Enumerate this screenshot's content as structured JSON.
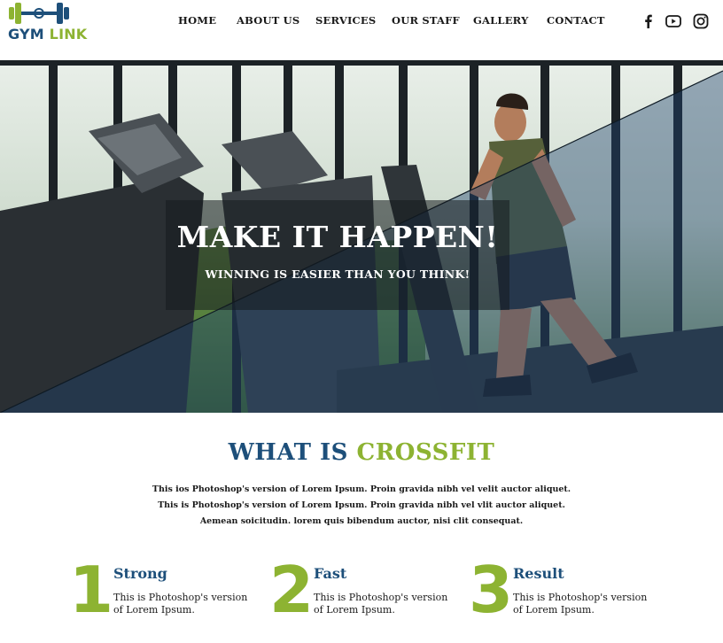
{
  "brand": {
    "name_part1": "GYM",
    "name_part2": "LINK",
    "logo_icon": "dumbbell-icon",
    "colors": {
      "blue": "#1d4f7a",
      "green": "#8db332"
    }
  },
  "nav": {
    "items": [
      "HOME",
      "ABOUT US",
      "SERVICES",
      "OUR STAFF",
      "GALLERY",
      "CONTACT"
    ]
  },
  "social": [
    "facebook-icon",
    "youtube-icon",
    "instagram-icon"
  ],
  "hero": {
    "title": "MAKE IT HAPPEN!",
    "subtitle": "WINNING IS EASIER THAN YOU THINK!"
  },
  "about": {
    "title_part1": "WHAT IS",
    "title_part2": "CROSSFIT",
    "lines": [
      "This ios Photoshop's version of Lorem Ipsum. Proin gravida nibh vel velit auctor aliquet.",
      "This is Photoshop's version of Lorem Ipsum. Proin gravida nibh vel vlit auctor aliquet.",
      "Aemean soicitudin. lorem quis bibendum auctor, nisi clit consequat."
    ]
  },
  "features": [
    {
      "number": "1",
      "title": "Strong",
      "desc": "This is Photoshop's version of Lorem Ipsum."
    },
    {
      "number": "2",
      "title": "Fast",
      "desc": "This is Photoshop's version of Lorem Ipsum."
    },
    {
      "number": "3",
      "title": "Result",
      "desc": "This is Photoshop's version of Lorem Ipsum."
    }
  ]
}
